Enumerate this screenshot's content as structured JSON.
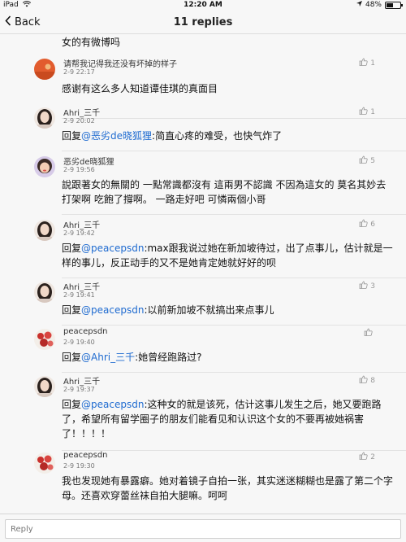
{
  "status_bar": {
    "carrier": "iPad",
    "time": "12:20 AM",
    "battery": "48%",
    "battery_level": 0.48
  },
  "nav": {
    "back_label": "Back",
    "title": "11 replies"
  },
  "continued_text": "女的有微博吗",
  "comments": [
    {
      "name": "请帮我记得我还没有坏掉的样子",
      "time": "2-9 22:17",
      "likes": "1",
      "body_plain": "感谢有这么多人知道谭佳琪的真面目"
    },
    {
      "name": "Ahri_三千",
      "time": "2-9 20:02",
      "likes": "1",
      "reply_prefix": "回复",
      "mention": "@恶劣de晓狐狸",
      "body_rest": ":简直心疼的难受，也快气炸了"
    },
    {
      "name": "恶劣de晓狐狸",
      "time": "2-9 19:56",
      "likes": "5",
      "body_plain": "說跟著女的無關的 一點常識都沒有 這兩男不認識 不因為這女的 莫名其妙去打架啊 吃飽了撐啊。 一路走好吧 可憐兩個小哥"
    },
    {
      "name": "Ahri_三千",
      "time": "2-9 19:42",
      "likes": "6",
      "reply_prefix": "回复",
      "mention": "@peacepsdn",
      "body_rest": ":max跟我说过她在新加坡待过，出了点事儿，估计就是一样的事儿，反正动手的又不是她肯定她就好好的呗"
    },
    {
      "name": "Ahri_三千",
      "time": "2-9 19:41",
      "likes": "3",
      "reply_prefix": "回复",
      "mention": "@peacepsdn",
      "body_rest": ":以前新加坡不就搞出来点事儿"
    },
    {
      "name": "peacepsdn",
      "time": "2-9 19:40",
      "likes": "",
      "reply_prefix": "回复",
      "mention": "@Ahri_三千",
      "body_rest": ":她曾经跑路过?"
    },
    {
      "name": "Ahri_三千",
      "time": "2-9 19:37",
      "likes": "8",
      "reply_prefix": "回复",
      "mention": "@peacepsdn",
      "body_rest": ":这种女的就是该死，估计这事儿发生之后，她又要跑路了，希望所有留学圈子的朋友们能看见和认识这个女的不要再被她祸害了！！！！"
    },
    {
      "name": "peacepsdn",
      "time": "2-9 19:30",
      "likes": "2",
      "body_plain": "我也发现她有暴露癖。她对着镜子自拍一张，其实迷迷糊糊也是露了第二个字母。还喜欢穿蕾丝袜自拍大腿嘛。呵呵"
    }
  ],
  "reply_bar": {
    "placeholder": "Reply"
  },
  "colors": {
    "mention": "#1f6bd0",
    "background": "#f7f7f7",
    "separator": "#e2e2e2"
  },
  "icons": {
    "back": "chevron-left-icon",
    "like": "thumbs-up-icon",
    "wifi": "wifi-icon",
    "battery": "battery-icon"
  }
}
